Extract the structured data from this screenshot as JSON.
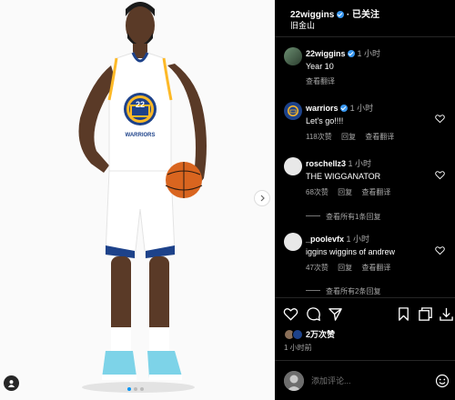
{
  "header": {
    "username": "22wiggins",
    "follow_state": "· 已关注",
    "location": "旧金山"
  },
  "caption": {
    "username": "22wiggins",
    "time": "1 小时",
    "text": "Year 10",
    "translate": "查看翻译"
  },
  "comments": [
    {
      "username": "warriors",
      "verified": true,
      "time": "1 小时",
      "text": "Let's go!!!!",
      "likes": "118次赞",
      "reply": "回复",
      "translate": "查看翻译",
      "view_replies": ""
    },
    {
      "username": "roschellz3",
      "verified": false,
      "time": "1 小时",
      "text": "THE WIGGANATOR",
      "likes": "68次赞",
      "reply": "回复",
      "translate": "查看翻译",
      "view_replies": "查看所有1条回复"
    },
    {
      "username": "_poolevfx",
      "verified": false,
      "time": "1 小时",
      "text": "iggins wiggins of andrew",
      "likes": "47次赞",
      "reply": "回复",
      "translate": "查看翻译",
      "view_replies": "查看所有2条回复"
    }
  ],
  "actions": {
    "like_icon": "heart-icon",
    "comment_icon": "comment-icon",
    "share_icon": "send-icon",
    "save_icon": "bookmark-icon",
    "carousel_icon": "copy-icon",
    "download_icon": "download-icon"
  },
  "likes": "2万次赞",
  "post_time": "1 小时前",
  "add_comment": {
    "placeholder": "添加评论..."
  },
  "jersey": {
    "number": "22",
    "team": "WARRIORS"
  },
  "colors": {
    "accent": "#0095f6",
    "warriors_blue": "#1d428a",
    "warriors_gold": "#fdb927",
    "verified": "#3897f0"
  }
}
